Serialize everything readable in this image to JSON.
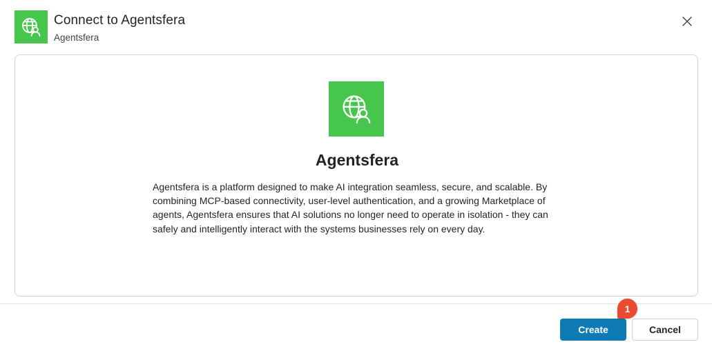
{
  "header": {
    "title": "Connect to Agentsfera",
    "subtitle": "Agentsfera",
    "icon": "globe-user-icon",
    "close_icon": "close-icon"
  },
  "card": {
    "icon": "globe-user-icon",
    "title": "Agentsfera",
    "description": "Agentsfera is a platform designed to make AI integration seamless, secure, and scalable. By combining MCP-based connectivity, user-level authentication, and a growing Marketplace of agents, Agentsfera ensures that AI solutions no longer need to operate in isolation - they can safely and intelligently interact with the systems businesses rely on every day."
  },
  "footer": {
    "create_label": "Create",
    "cancel_label": "Cancel",
    "step_badge": "1"
  },
  "colors": {
    "brand_green": "#46c64c",
    "primary_button": "#0e7bb5",
    "badge": "#ea4a2f"
  }
}
